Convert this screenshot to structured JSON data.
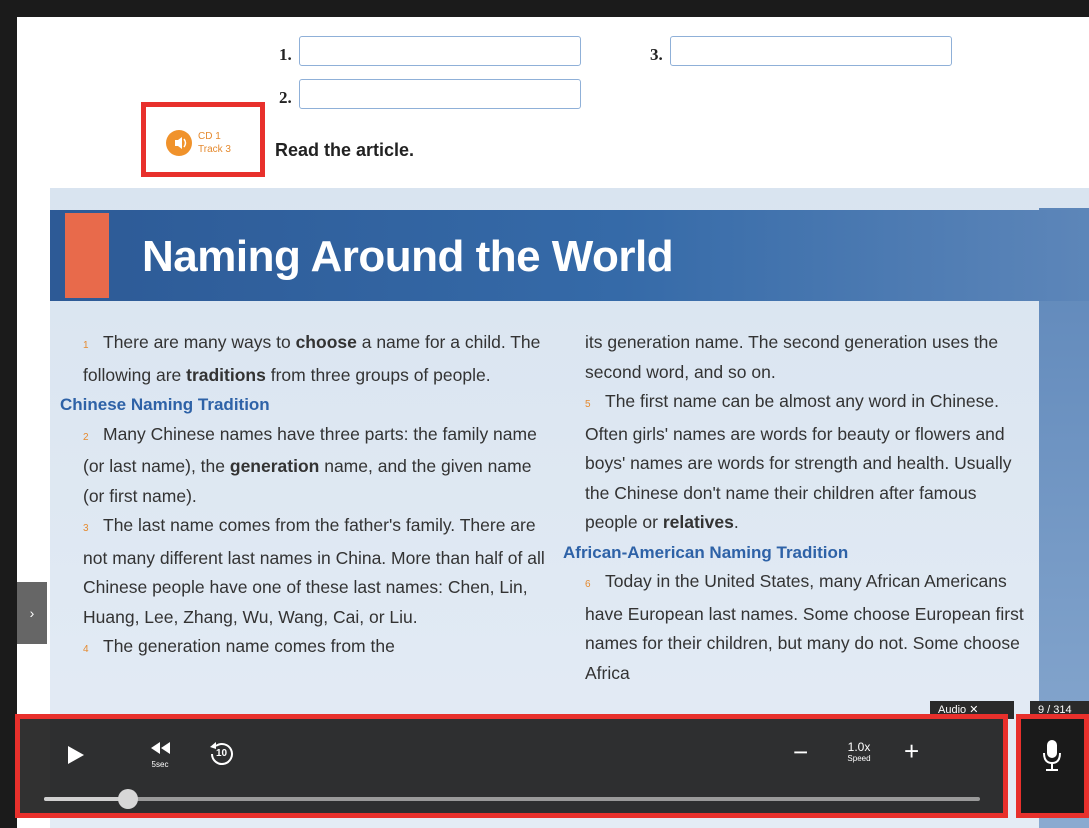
{
  "exercise": {
    "labels": [
      "1.",
      "2.",
      "3."
    ]
  },
  "audio_badge": {
    "line1": "CD 1",
    "line2": "Track 3",
    "icon": "speaker-icon"
  },
  "instruction": "Read the article.",
  "article": {
    "title": "Naming Around the World",
    "left_column": {
      "p1_num": "1",
      "p1": [
        "There are many ways to ",
        "choose",
        " a name for a child. The following are ",
        "traditions",
        " from three groups of people."
      ],
      "heading1": "Chinese Naming Tradition",
      "p2_num": "2",
      "p2": [
        "Many Chinese names have three parts: the family name (or last name), the ",
        "generation",
        " name, and the given name (or first name)."
      ],
      "p3_num": "3",
      "p3": "The last name comes from the father's family. There are not many different last names in China. More than half of all Chinese people have one of these last names: Chen, Lin, Huang, Lee, Zhang, Wu, Wang, Cai, or Liu.",
      "p4_num": "4",
      "p4": "The generation name comes from the"
    },
    "right_column": {
      "p4_cont": "its generation name. The second generation uses the second word, and so on.",
      "p5_num": "5",
      "p5": [
        "The first name can be almost any word in Chinese. Often girls' names are words for beauty or flowers and boys' names are words for strength and health. Usually the Chinese don't name their children after famous people or ",
        "relatives",
        "."
      ],
      "heading2": "African-American Naming Tradition",
      "p6_num": "6",
      "p6": "Today in the United States, many African Americans have European last names. Some choose European first names for their children, but many do not. Some choose Africa"
    }
  },
  "player": {
    "play_icon": "play-icon",
    "rewind_label": "5sec",
    "replay_label": "10",
    "speed_value": "1.0x",
    "speed_label": "Speed",
    "minus": "−",
    "plus": "+",
    "progress": 0.09
  },
  "overlay": {
    "audio_tag": "Audio ✕",
    "page_tag": "9 / 314"
  },
  "mic": {
    "icon": "microphone-icon"
  },
  "sidebar_toggle": "›"
}
